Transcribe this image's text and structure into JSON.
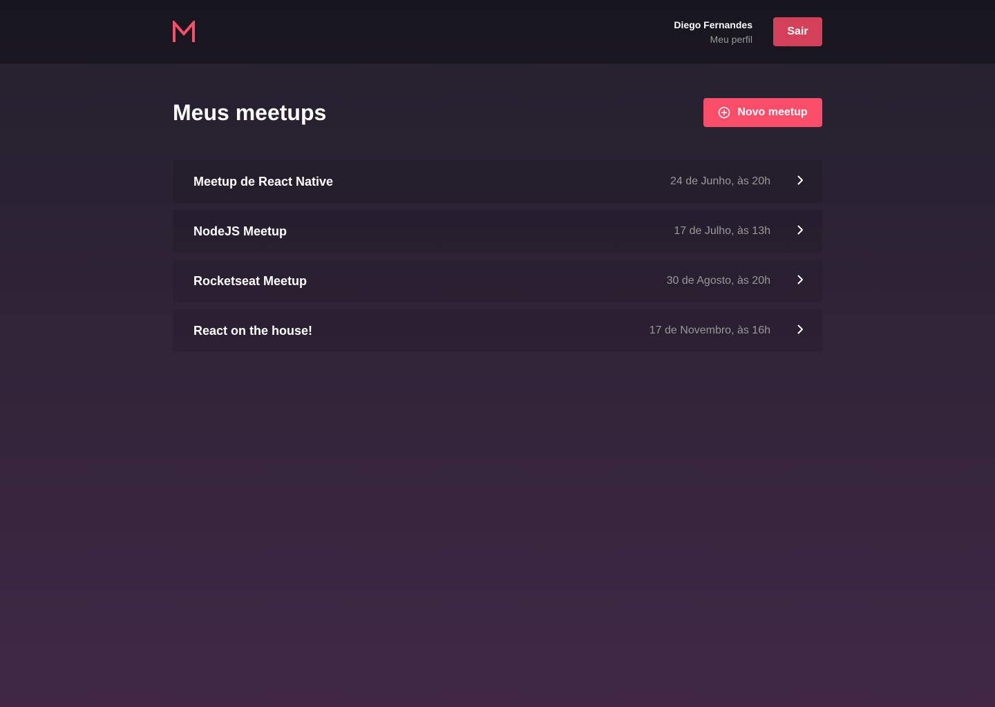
{
  "header": {
    "logo_icon": "meetapp-logo-icon",
    "user_name": "Diego Fernandes",
    "profile_link": "Meu perfil",
    "logout_label": "Sair"
  },
  "page": {
    "title": "Meus meetups",
    "new_button_label": "Novo meetup",
    "new_button_icon": "add-circle-icon"
  },
  "meetups": [
    {
      "title": "Meetup de React Native",
      "date": "24 de Junho, às 20h"
    },
    {
      "title": "NodeJS Meetup",
      "date": "17 de Julho, às 13h"
    },
    {
      "title": "Rocketseat Meetup",
      "date": "30 de Agosto, às 20h"
    },
    {
      "title": "React on the house!",
      "date": "17 de Novembro, às 16h"
    }
  ],
  "colors": {
    "accent": "#f94d6a",
    "logout": "#d44059",
    "background_top": "#22202c",
    "background_bottom": "#402845",
    "muted_text": "#999999"
  }
}
